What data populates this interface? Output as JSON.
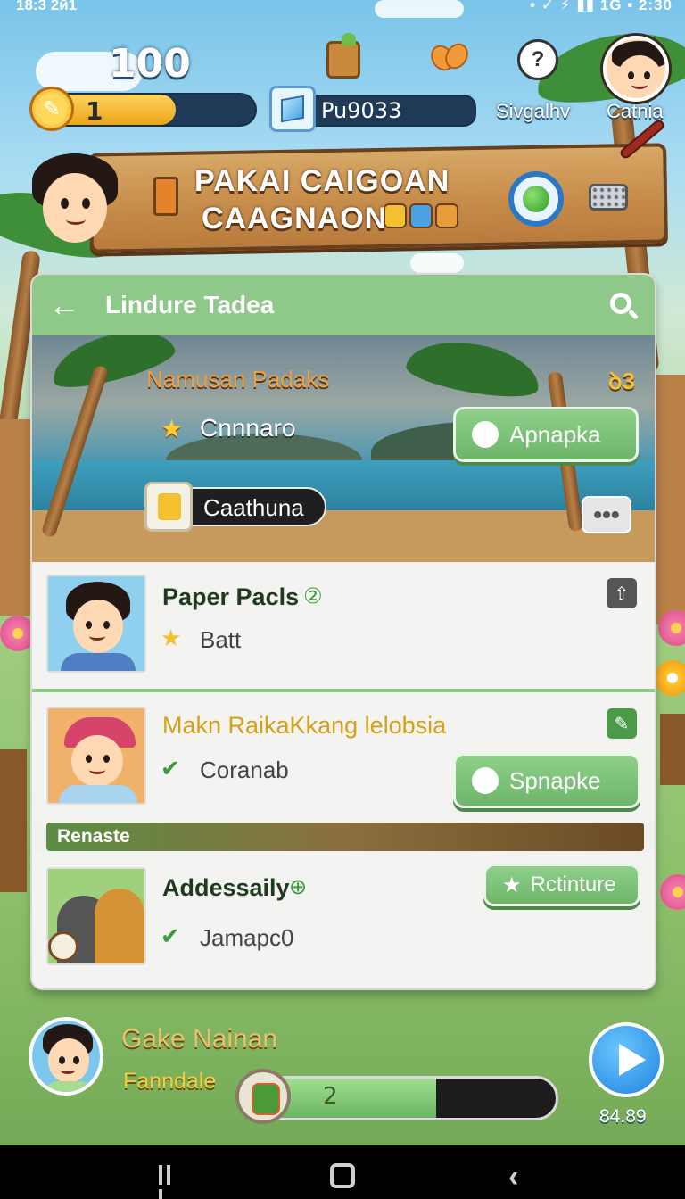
{
  "status_bar": {
    "time": "18:3 2й1",
    "right": "• ✓ ⚡ ▮▮ 1G ▪ 2:30"
  },
  "hud": {
    "coins": "100",
    "xp_level": "1",
    "xp_progress": 0.64,
    "gems": "Pu9033",
    "help_label": "Sivgalhv",
    "profile_label": "Catnia"
  },
  "sign": {
    "line1": "PAKAI CAIGOAN",
    "line2": "CAAGNAON"
  },
  "panel": {
    "title": "Lindure Tadea",
    "hero": {
      "title": "Namusan Padaks",
      "badge": "ꝺ3",
      "subtitle": "Cnnnaro",
      "cta_label": "Apnapka",
      "tag_label": "Caathuna",
      "more_label": "•••"
    },
    "items": [
      {
        "title": "Paper Pacls",
        "badge": "②",
        "subtitle": "Batt",
        "accent": "#1f3b1e"
      },
      {
        "title": "Makn RaikaKkang lelobsia",
        "subtitle": "Coranab",
        "button_label": "Spnapke",
        "accent": "#d4a017"
      },
      {
        "title": "Addessaily",
        "badge": "⊕",
        "subtitle": "Jamapc0",
        "button_label": "Rctinture",
        "accent": "#1f3b1e"
      }
    ],
    "section_label": "Renaste"
  },
  "bottom": {
    "name": "Gake Nainan",
    "subtitle": "Fanndale",
    "progress_value": "2",
    "progress_fraction": 0.62,
    "play_value": "84.89"
  },
  "colors": {
    "primary_green": "#8fc98a",
    "gold": "#d4a017",
    "sky": "#79c4ea",
    "wood": "#c88e4c"
  }
}
